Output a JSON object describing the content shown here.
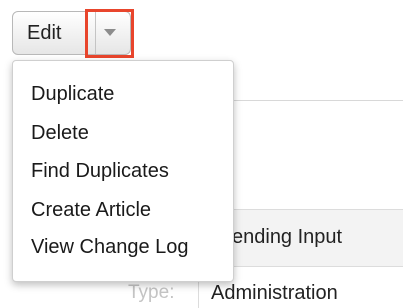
{
  "actions": {
    "edit_label": "Edit",
    "caret_icon": "caret-down-icon",
    "highlight_color": "#e8452c"
  },
  "menu": {
    "items": [
      {
        "label": "Duplicate"
      },
      {
        "label": "Delete"
      },
      {
        "label": "Find Duplicates"
      },
      {
        "label": "Create Article"
      },
      {
        "label": "View Change Log"
      }
    ]
  },
  "record": {
    "status_value": "ending Input",
    "type_label": "Type:",
    "type_value": "Administration"
  }
}
